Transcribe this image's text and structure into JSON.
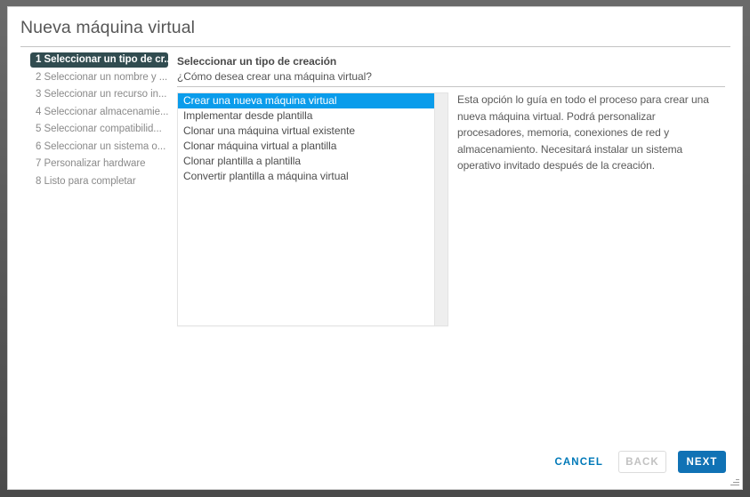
{
  "window": {
    "title": "Nueva máquina virtual"
  },
  "steps": [
    {
      "label": "1 Seleccionar un tipo de cr...",
      "active": true
    },
    {
      "label": "2 Seleccionar un nombre y ...",
      "active": false
    },
    {
      "label": "3 Seleccionar un recurso in...",
      "active": false
    },
    {
      "label": "4 Seleccionar almacenamie...",
      "active": false
    },
    {
      "label": "5 Seleccionar compatibilid...",
      "active": false
    },
    {
      "label": "6 Seleccionar un sistema o...",
      "active": false
    },
    {
      "label": "7 Personalizar hardware",
      "active": false
    },
    {
      "label": "8 Listo para completar",
      "active": false
    }
  ],
  "main": {
    "header": "Seleccionar un tipo de creación",
    "subheader": "¿Cómo desea crear una máquina virtual?",
    "options": [
      {
        "label": "Crear una nueva máquina virtual",
        "selected": true
      },
      {
        "label": "Implementar desde plantilla",
        "selected": false
      },
      {
        "label": "Clonar una máquina virtual existente",
        "selected": false
      },
      {
        "label": "Clonar máquina virtual a plantilla",
        "selected": false
      },
      {
        "label": "Clonar plantilla a plantilla",
        "selected": false
      },
      {
        "label": "Convertir plantilla a máquina virtual",
        "selected": false
      }
    ],
    "description": "Esta opción lo guía en todo el proceso para crear una nueva máquina virtual. Podrá personalizar procesadores, memoria, conexiones de red y almacenamiento. Necesitará instalar un sistema operativo invitado después de la creación."
  },
  "footer": {
    "cancel_label": "CANCEL",
    "back_label": "BACK",
    "next_label": "NEXT"
  },
  "colors": {
    "accent_blue": "#0a9ceb",
    "button_blue": "#1072b5",
    "link_blue": "#0079b8",
    "step_active_bg": "#314c50"
  }
}
